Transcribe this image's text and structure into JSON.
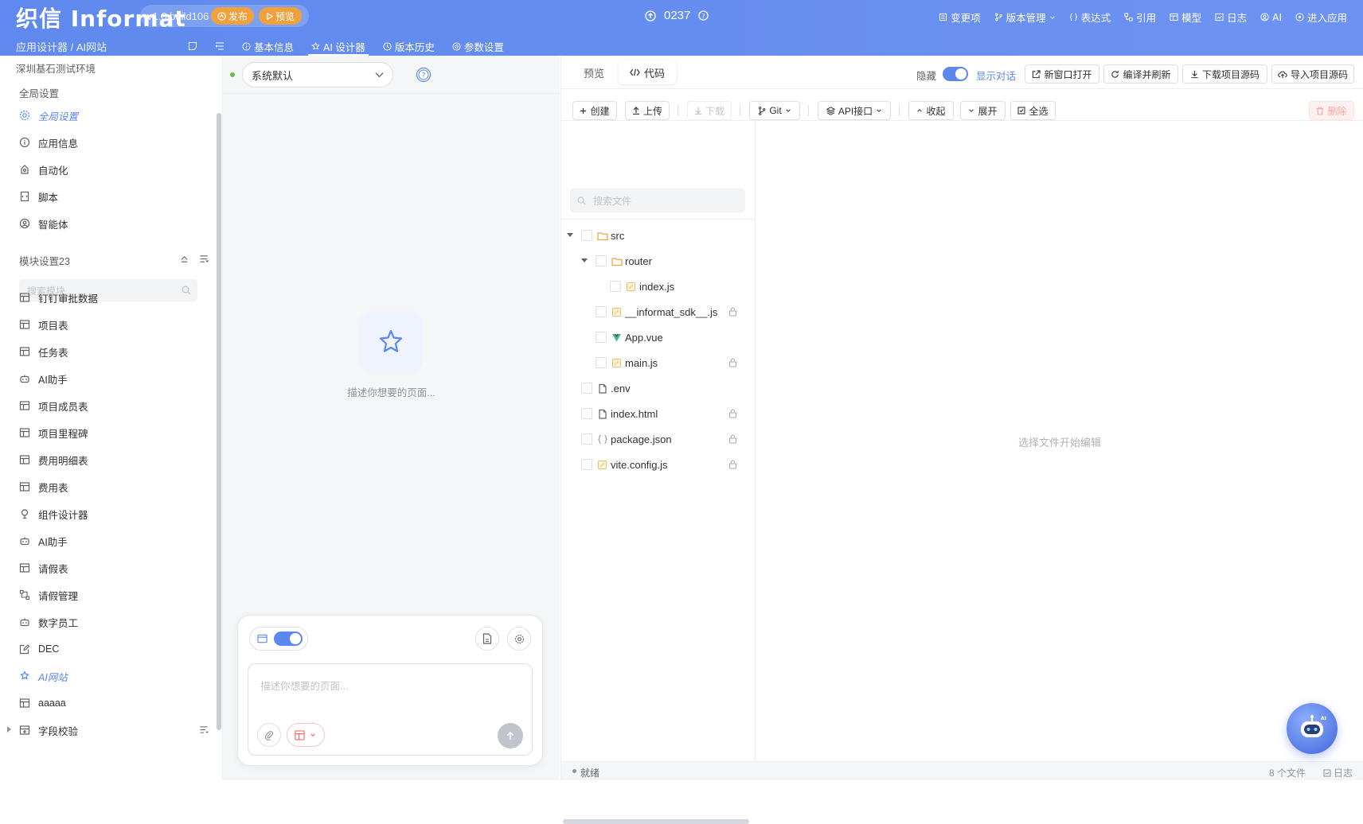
{
  "header": {
    "logo": "织信 Informat",
    "version": "v1.0 build106",
    "publish_label": "发布",
    "preview_label": "预览",
    "app_id": "0237",
    "menu": [
      {
        "label": "变更项",
        "icon": "list-icon"
      },
      {
        "label": "版本管理",
        "icon": "branch-icon"
      },
      {
        "label": "表达式",
        "icon": "braces-icon"
      },
      {
        "label": "引用",
        "icon": "reference-icon"
      },
      {
        "label": "模型",
        "icon": "table-icon"
      },
      {
        "label": "日志",
        "icon": "log-icon"
      },
      {
        "label": "AI",
        "icon": "ai-icon"
      },
      {
        "label": "进入应用",
        "icon": "enter-icon"
      }
    ],
    "breadcrumb": "应用设计器 / AI网站",
    "tabs": [
      {
        "label": "基本信息",
        "icon": "info-icon"
      },
      {
        "label": "AI 设计器",
        "icon": "ai-designer-icon",
        "active": true
      },
      {
        "label": "版本历史",
        "icon": "history-icon"
      },
      {
        "label": "参数设置",
        "icon": "settings-icon"
      }
    ]
  },
  "sidebar": {
    "environment": "深圳基石测试环境",
    "global_section": "全局设置",
    "global_items": [
      {
        "label": "全局设置",
        "icon": "gear-icon",
        "active": true
      },
      {
        "label": "应用信息",
        "icon": "info-icon"
      },
      {
        "label": "自动化",
        "icon": "automation-icon"
      },
      {
        "label": "脚本",
        "icon": "script-icon"
      },
      {
        "label": "智能体",
        "icon": "agent-icon"
      }
    ],
    "module_section": "模块设置23",
    "search_placeholder": "搜索模块",
    "modules": [
      {
        "label": "钉钉审批数据",
        "icon": "table-icon"
      },
      {
        "label": "项目表",
        "icon": "table-icon"
      },
      {
        "label": "任务表",
        "icon": "table-icon"
      },
      {
        "label": "AI助手",
        "icon": "robot-icon"
      },
      {
        "label": "项目成员表",
        "icon": "table-icon"
      },
      {
        "label": "项目里程碑",
        "icon": "table-icon"
      },
      {
        "label": "费用明细表",
        "icon": "table-icon"
      },
      {
        "label": "费用表",
        "icon": "table-icon"
      },
      {
        "label": "组件设计器",
        "icon": "component-icon"
      },
      {
        "label": "AI助手",
        "icon": "robot-icon"
      },
      {
        "label": "请假表",
        "icon": "table-icon"
      },
      {
        "label": "请假管理",
        "icon": "workflow-icon"
      },
      {
        "label": "数字员工",
        "icon": "robot-icon"
      },
      {
        "label": "DEC",
        "icon": "edit-icon"
      },
      {
        "label": "AI网站",
        "icon": "ai-designer-icon",
        "active": true
      },
      {
        "label": "aaaaa",
        "icon": "table-icon"
      },
      {
        "label": "字段校验",
        "icon": "add-table-icon"
      }
    ]
  },
  "chat": {
    "model_select": "系统默认",
    "empty_hint": "描述你想要的页面...",
    "input_placeholder": "描述你想要的页面..."
  },
  "code": {
    "tabs": [
      "预览",
      "代码"
    ],
    "hide_label": "隐藏",
    "show_chat_label": "显示对话",
    "actions": [
      "新窗口打开",
      "编译并刷新",
      "下载项目源码",
      "导入项目源码"
    ],
    "toolbar": {
      "create": "创建",
      "upload": "上传",
      "download": "下载",
      "git": "Git",
      "api": "API接口",
      "collapse": "收起",
      "expand": "展开",
      "select_all": "全选",
      "delete": "删除"
    },
    "file_search_placeholder": "搜索文件",
    "files": [
      {
        "name": "src",
        "type": "folder",
        "depth": 0,
        "expanded": true
      },
      {
        "name": "router",
        "type": "folder",
        "depth": 1,
        "expanded": true
      },
      {
        "name": "index.js",
        "type": "js",
        "depth": 2
      },
      {
        "name": "__informat_sdk__.js",
        "type": "js",
        "depth": 1,
        "locked": true
      },
      {
        "name": "App.vue",
        "type": "vue",
        "depth": 1
      },
      {
        "name": "main.js",
        "type": "js",
        "depth": 1,
        "locked": true
      },
      {
        "name": ".env",
        "type": "file",
        "depth": 0
      },
      {
        "name": "index.html",
        "type": "file",
        "depth": 0,
        "locked": true
      },
      {
        "name": "package.json",
        "type": "json",
        "depth": 0,
        "locked": true
      },
      {
        "name": "vite.config.js",
        "type": "js",
        "depth": 0,
        "locked": true
      }
    ],
    "editor_placeholder": "选择文件开始编辑",
    "status": "就绪",
    "file_count": "8 个文件",
    "log_label": "日志"
  },
  "colors": {
    "accent": "#5b87ee",
    "header_bg": "#6790f0",
    "publish_orange": "#f0a13c",
    "danger": "#f56c6c"
  }
}
